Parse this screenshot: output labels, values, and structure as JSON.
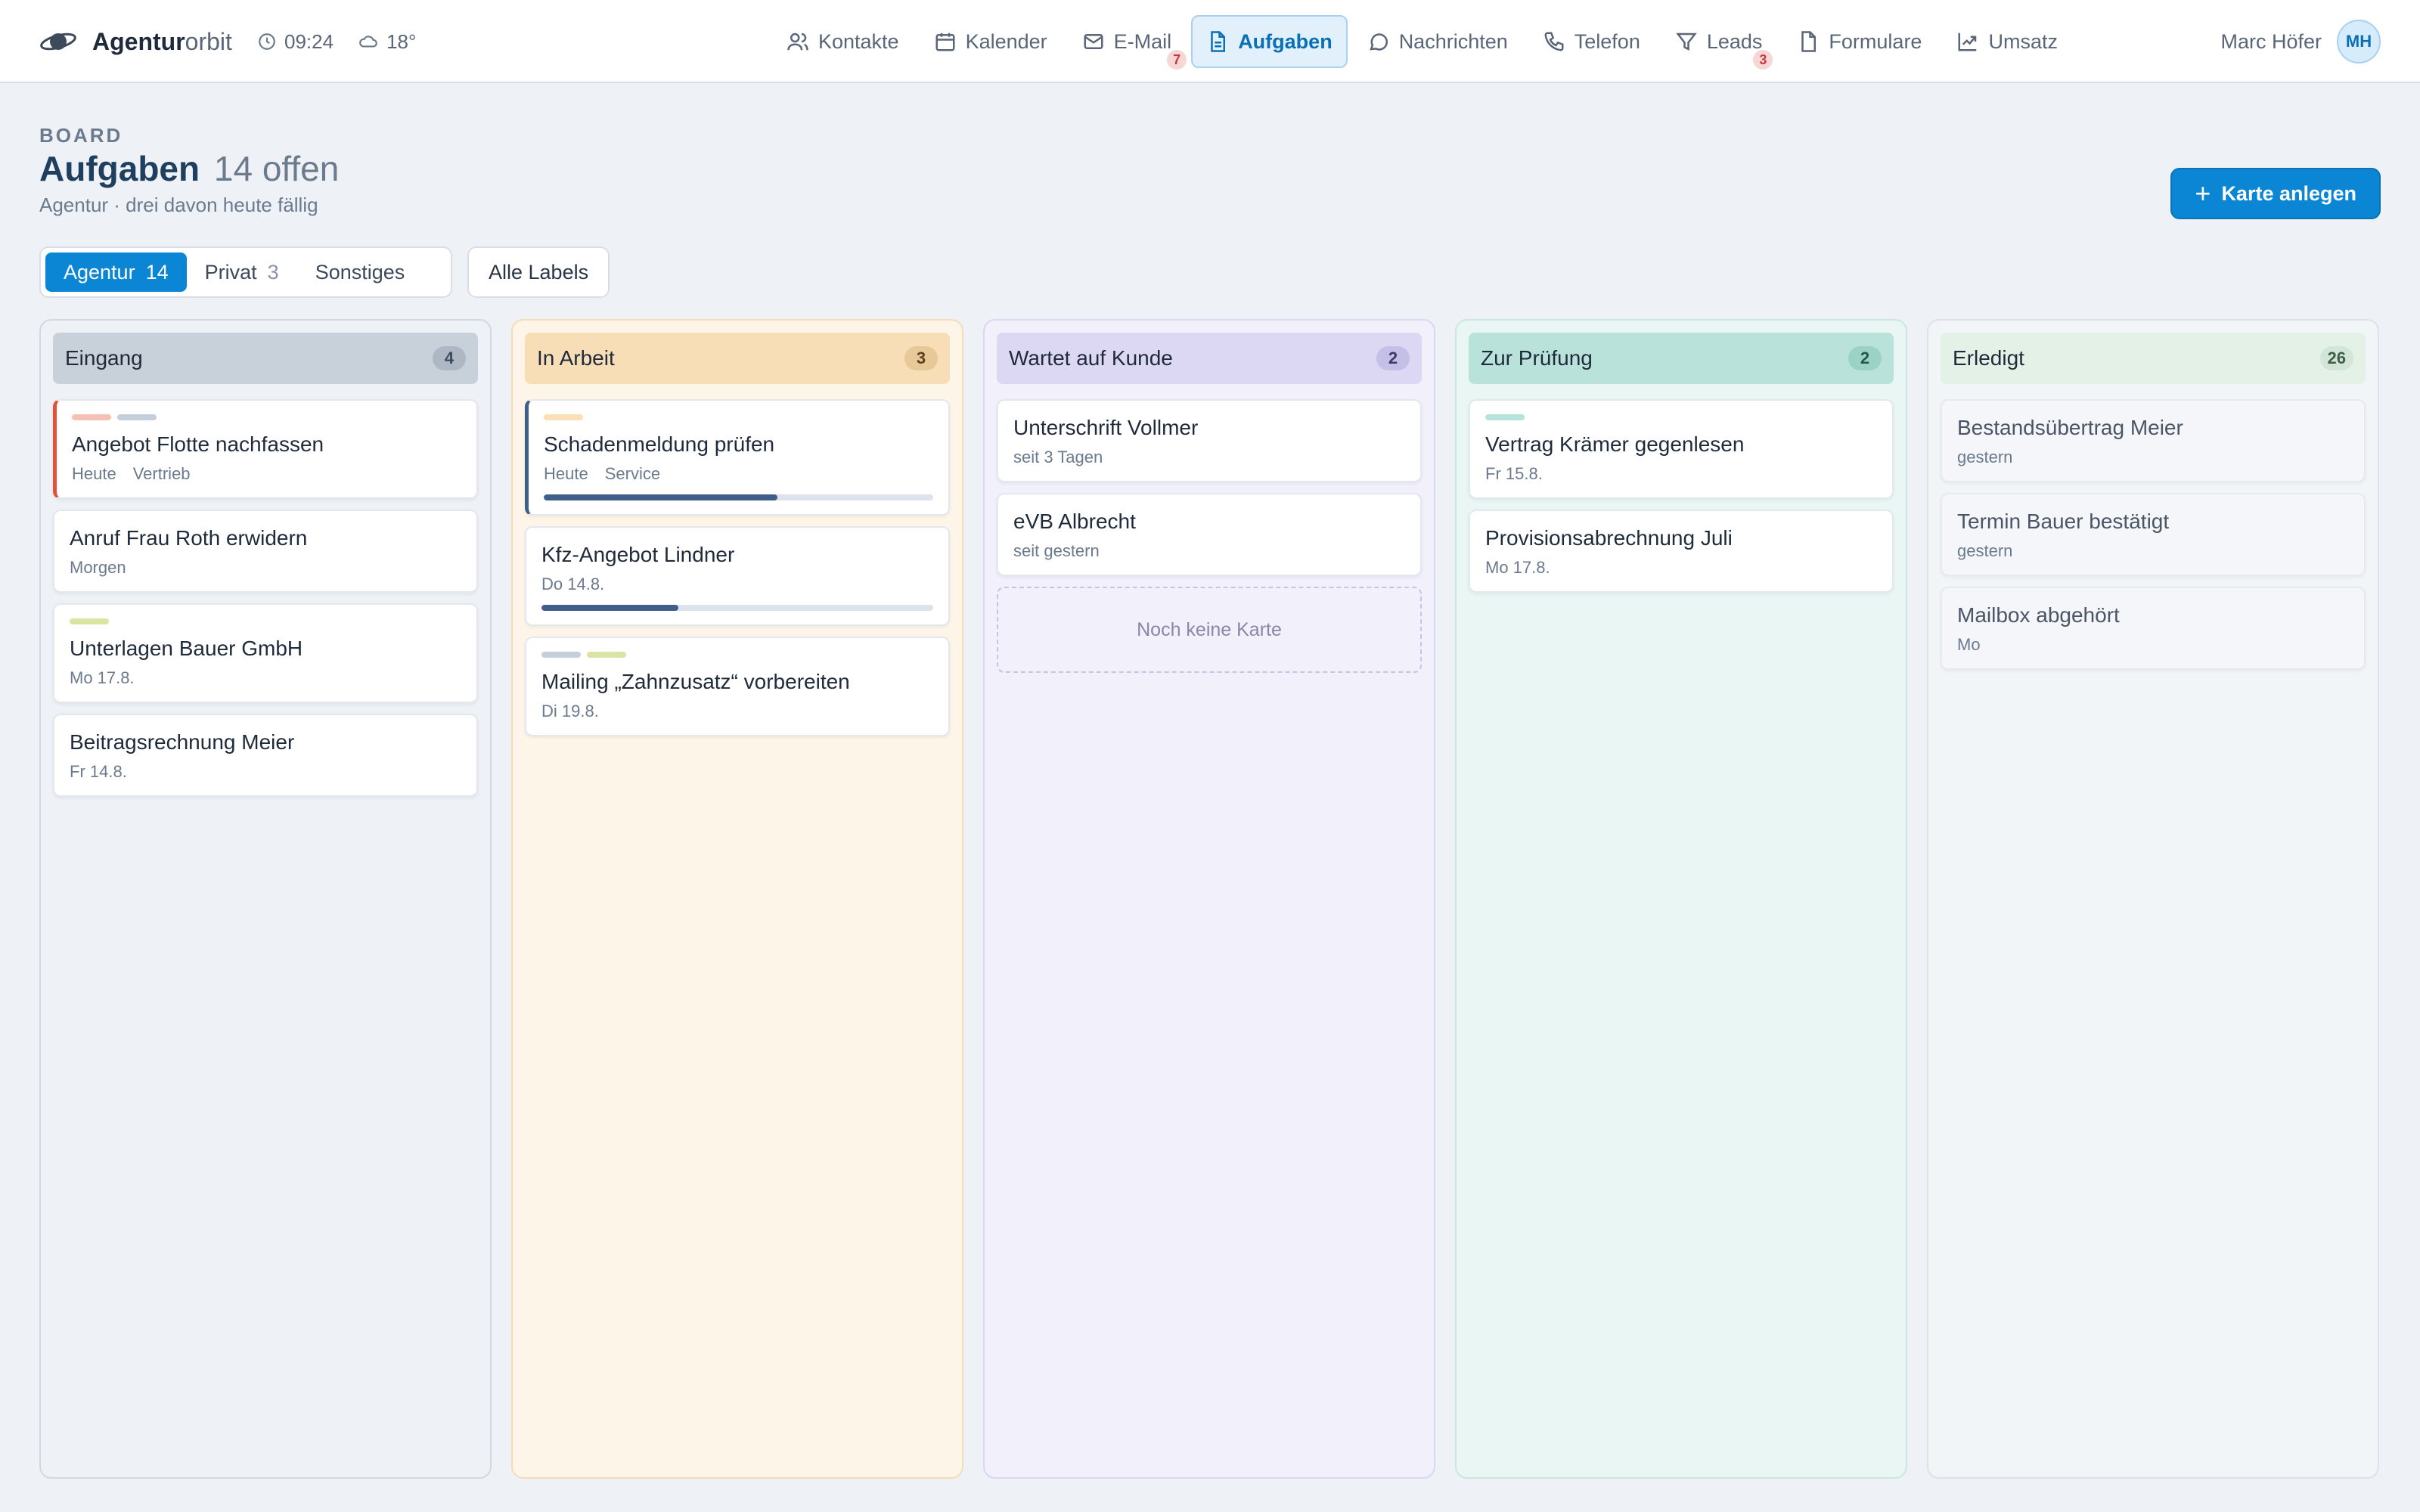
{
  "app": {
    "brand_bold": "Agentur",
    "brand_light": "orbit",
    "time": "09:24",
    "weather": "18°"
  },
  "nav": {
    "kontakte": "Kontakte",
    "kalender": "Kalender",
    "email": "E-Mail",
    "email_badge": "7",
    "aufgaben": "Aufgaben",
    "nachrichten": "Nachrichten",
    "telefon": "Telefon",
    "leads": "Leads",
    "leads_badge": "3",
    "formulare": "Formulare",
    "umsatz": "Umsatz"
  },
  "user": {
    "name": "Marc Höfer",
    "initials": "MH"
  },
  "header": {
    "kicker": "BOARD",
    "title": "Aufgaben",
    "count": "14 offen",
    "subtitle": "Agentur · drei davon heute fällig",
    "add_button": "Karte anlegen"
  },
  "filters": {
    "agentur": "Agentur",
    "agentur_n": "14",
    "privat": "Privat",
    "privat_n": "3",
    "sonstiges": "Sonstiges",
    "labels": "Alle Labels"
  },
  "columns": [
    {
      "title": "Eingang",
      "count": "4",
      "cards": [
        {
          "title": "Angebot Flotte nachfassen",
          "due": "Heute",
          "label": "Vertrieb"
        },
        {
          "title": "Anruf Frau Roth erwidern",
          "due": "Morgen"
        },
        {
          "title": "Unterlagen Bauer GmbH",
          "due": "Mo 17.8."
        },
        {
          "title": "Beitragsrechnung Meier",
          "due": "Fr 14.8."
        }
      ]
    },
    {
      "title": "In Arbeit",
      "count": "3",
      "cards": [
        {
          "title": "Schadenmeldung prüfen",
          "due": "Heute",
          "label": "Service",
          "progress": 0.6
        },
        {
          "title": "Kfz-Angebot Lindner",
          "due": "Do 14.8.",
          "progress": 0.35
        },
        {
          "title": "Mailing „Zahnzusatz“ vorbereiten",
          "due": "Di 19.8."
        }
      ]
    },
    {
      "title": "Wartet auf Kunde",
      "count": "2",
      "cards": [
        {
          "title": "Unterschrift Vollmer",
          "due": "seit 3 Tagen"
        },
        {
          "title": "eVB Albrecht",
          "due": "seit gestern"
        }
      ],
      "empty": "Noch keine Karte"
    },
    {
      "title": "Zur Prüfung",
      "count": "2",
      "cards": [
        {
          "title": "Vertrag Krämer gegenlesen",
          "due": "Fr 15.8."
        },
        {
          "title": "Provisionsabrechnung Juli",
          "due": "Mo 17.8."
        }
      ]
    },
    {
      "title": "Erledigt",
      "count": "26",
      "cards": [
        {
          "title": "Bestandsübertrag Meier",
          "due": "gestern"
        },
        {
          "title": "Termin Bauer bestätigt",
          "due": "gestern"
        },
        {
          "title": "Mailbox abgehört",
          "due": "Mo"
        }
      ]
    }
  ],
  "colors": {
    "accent": "#0b86d4",
    "urgent": "#e2523b",
    "progress": "#3f5f8a"
  }
}
